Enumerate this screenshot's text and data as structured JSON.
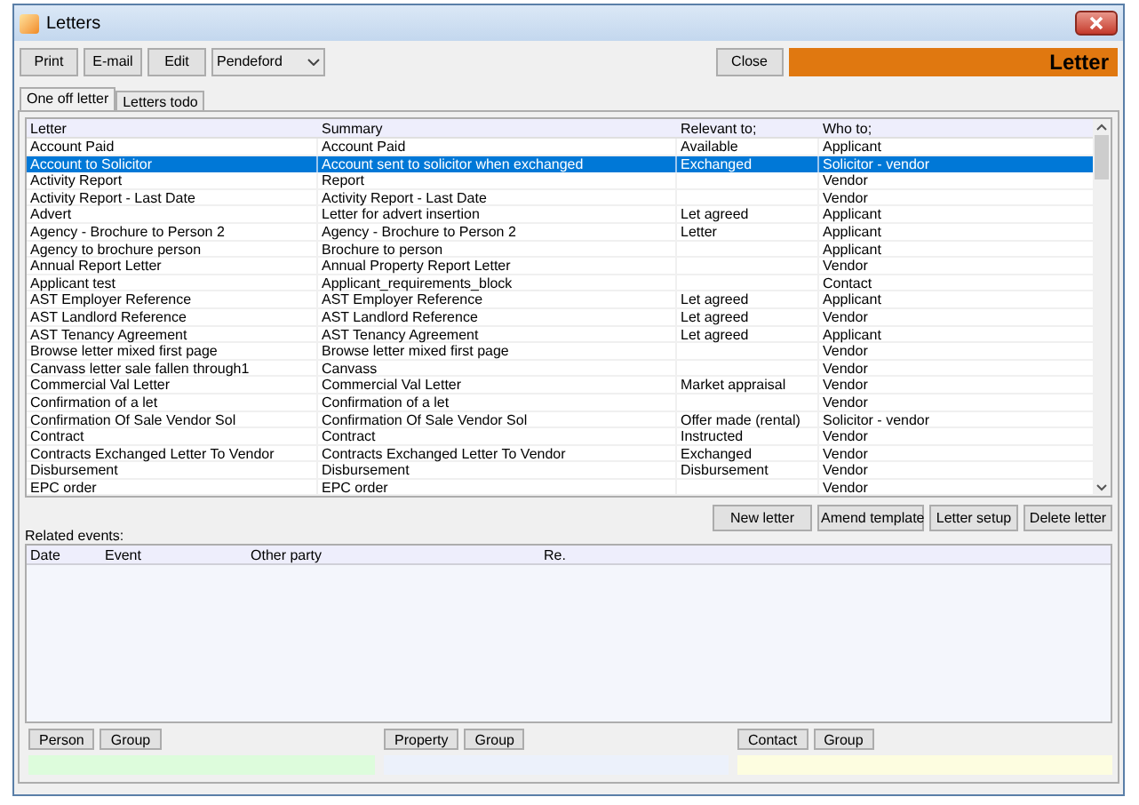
{
  "window": {
    "title": "Letters"
  },
  "toolbar": {
    "buttons": [
      "Print",
      "E-mail",
      "Edit"
    ],
    "branch": "Pendeford",
    "close": "Close",
    "banner": "Letter"
  },
  "tabs": [
    {
      "label": "One off letter",
      "selected": true
    },
    {
      "label": "Letters todo",
      "selected": false
    }
  ],
  "letters": {
    "columns": [
      "Letter",
      "Summary",
      "Relevant to;",
      "Who to;"
    ],
    "rows": [
      {
        "cells": [
          "Account Paid",
          "Account Paid",
          "Available",
          "Applicant"
        ],
        "selected": false
      },
      {
        "cells": [
          "Account to Solicitor",
          "Account sent to solicitor when exchanged",
          "Exchanged",
          "Solicitor - vendor"
        ],
        "selected": true
      },
      {
        "cells": [
          "Activity Report",
          "Report",
          "",
          "Vendor"
        ],
        "selected": false
      },
      {
        "cells": [
          "Activity Report - Last Date",
          "Activity Report - Last Date",
          "",
          "Vendor"
        ],
        "selected": false
      },
      {
        "cells": [
          "Advert",
          "Letter for advert insertion",
          "Let agreed",
          "Applicant"
        ],
        "selected": false
      },
      {
        "cells": [
          "Agency - Brochure to Person 2",
          "Agency - Brochure to Person 2",
          "Letter",
          "Applicant"
        ],
        "selected": false
      },
      {
        "cells": [
          "Agency to brochure person",
          "Brochure to person",
          "",
          "Applicant"
        ],
        "selected": false
      },
      {
        "cells": [
          "Annual Report Letter",
          "Annual Property Report Letter",
          "",
          "Vendor"
        ],
        "selected": false
      },
      {
        "cells": [
          "Applicant test",
          "Applicant_requirements_block",
          "",
          "Contact"
        ],
        "selected": false
      },
      {
        "cells": [
          "AST Employer Reference",
          "AST Employer Reference",
          "Let agreed",
          "Applicant"
        ],
        "selected": false
      },
      {
        "cells": [
          "AST Landlord Reference",
          "AST Landlord Reference",
          "Let agreed",
          "Vendor"
        ],
        "selected": false
      },
      {
        "cells": [
          "AST Tenancy Agreement",
          "AST Tenancy Agreement",
          "Let agreed",
          "Applicant"
        ],
        "selected": false
      },
      {
        "cells": [
          "Browse letter mixed first page",
          "Browse letter mixed first page",
          "",
          "Vendor"
        ],
        "selected": false
      },
      {
        "cells": [
          "Canvass letter sale fallen through1",
          "Canvass",
          "",
          "Vendor"
        ],
        "selected": false
      },
      {
        "cells": [
          "Commercial Val Letter",
          "Commercial Val Letter",
          "Market appraisal",
          "Vendor"
        ],
        "selected": false
      },
      {
        "cells": [
          "Confirmation of a let",
          "Confirmation of a let",
          "",
          "Vendor"
        ],
        "selected": false
      },
      {
        "cells": [
          "Confirmation Of Sale Vendor Sol",
          "Confirmation Of Sale Vendor Sol",
          "Offer made (rental)",
          "Solicitor - vendor"
        ],
        "selected": false
      },
      {
        "cells": [
          "Contract",
          "Contract",
          "Instructed",
          "Vendor"
        ],
        "selected": false
      },
      {
        "cells": [
          "Contracts Exchanged Letter To Vendor",
          "Contracts Exchanged Letter To Vendor",
          "Exchanged",
          "Vendor"
        ],
        "selected": false
      },
      {
        "cells": [
          "Disbursement",
          "Disbursement",
          "Disbursement",
          "Vendor"
        ],
        "selected": false
      },
      {
        "cells": [
          "EPC order",
          "EPC order",
          "",
          "Vendor"
        ],
        "selected": false
      }
    ]
  },
  "letter_actions": [
    "New letter",
    "Amend template",
    "Letter setup",
    "Delete letter"
  ],
  "related_events": {
    "label": "Related events:",
    "columns": [
      "Date",
      "Event",
      "Other party",
      "Re."
    ]
  },
  "link_groups": [
    {
      "buttons": [
        "Person",
        "Group"
      ],
      "color": "#ddfcdc"
    },
    {
      "buttons": [
        "Property",
        "Group"
      ],
      "color": "#ecf1fb"
    },
    {
      "buttons": [
        "Contact",
        "Group"
      ],
      "color": "#fdfde0"
    }
  ]
}
